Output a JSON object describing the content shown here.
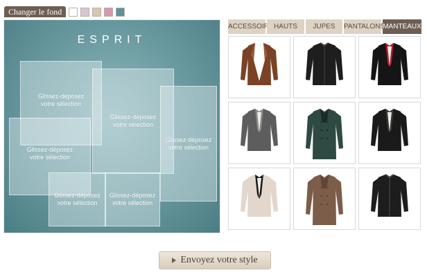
{
  "background_bar": {
    "label": "Changer le fond",
    "swatches": [
      {
        "name": "white",
        "color": "#ffffff"
      },
      {
        "name": "lilac",
        "color": "#d9c5cf"
      },
      {
        "name": "beige",
        "color": "#d8c7ad"
      },
      {
        "name": "pink",
        "color": "#d995b0"
      },
      {
        "name": "teal",
        "color": "#5f9199"
      }
    ]
  },
  "canvas": {
    "brand": "ESPRIT",
    "drop_text": "Glissez-déposez votre sélection"
  },
  "tabs": [
    {
      "label": "ACCESSOIRES",
      "active": false
    },
    {
      "label": "HAUTS",
      "active": false
    },
    {
      "label": "JUPES",
      "active": false
    },
    {
      "label": "PANTALONS",
      "active": false
    },
    {
      "label": "MANTEAUX",
      "active": true
    }
  ],
  "products": [
    {
      "name": "brown-leather-jacket-icon",
      "color": "#7a4326",
      "accent": "#9a5a38",
      "style": "open"
    },
    {
      "name": "black-leather-jacket-icon",
      "color": "#1e1e1e",
      "accent": "#3a3a3a",
      "style": "zip"
    },
    {
      "name": "black-blazer-red-lining-icon",
      "color": "#151515",
      "accent": "#b0182a",
      "style": "blazer"
    },
    {
      "name": "grey-tweed-blazer-icon",
      "color": "#5d5d5d",
      "accent": "#8a8a8a",
      "style": "blazer"
    },
    {
      "name": "green-plaid-coat-icon",
      "color": "#2e4a42",
      "accent": "#1c2b28",
      "style": "coat"
    },
    {
      "name": "black-fitted-blazer-icon",
      "color": "#1a1a1a",
      "accent": "#383838",
      "style": "blazer"
    },
    {
      "name": "cream-tuxedo-blazer-icon",
      "color": "#e3d6cc",
      "accent": "#1a1a1a",
      "style": "blazer"
    },
    {
      "name": "brown-wool-coat-icon",
      "color": "#7b5d4a",
      "accent": "#5f4536",
      "style": "coat"
    },
    {
      "name": "black-quilted-jacket-icon",
      "color": "#1d1d1d",
      "accent": "#444444",
      "style": "zip"
    }
  ],
  "send_button": {
    "label": "Envoyez votre style"
  }
}
